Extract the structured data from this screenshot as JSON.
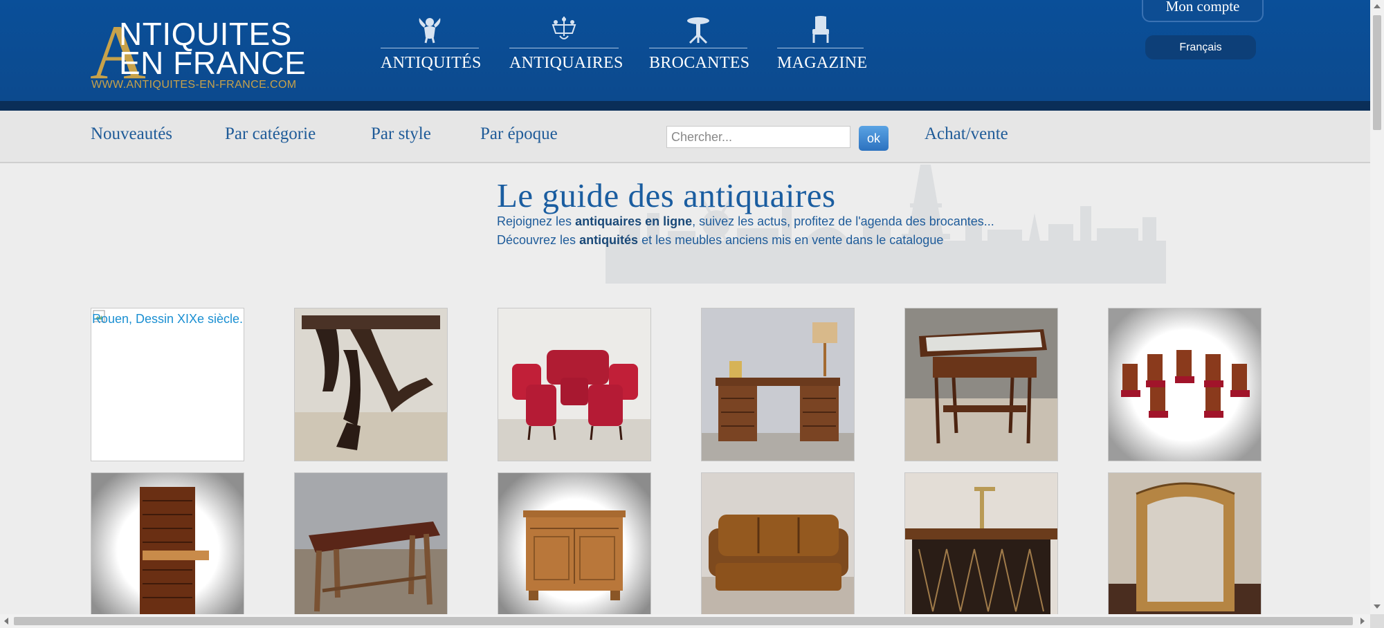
{
  "logo": {
    "big_letter": "A",
    "line1": "NTIQUITES",
    "line2": "EN FRANCE",
    "url": "WWW.ANTIQUITES-EN-FRANCE.COM"
  },
  "main_nav": [
    {
      "label": "ANTIQUITÉS",
      "icon": "cherub-icon"
    },
    {
      "label": "ANTIQUAIRES",
      "icon": "chandelier-icon"
    },
    {
      "label": "BROCANTES",
      "icon": "pedestal-table-icon"
    },
    {
      "label": "MAGAZINE",
      "icon": "armchair-icon"
    }
  ],
  "account": {
    "label": "Mon compte"
  },
  "language": {
    "label": "Français"
  },
  "sub_nav": {
    "items": [
      "Nouveautés",
      "Par catégorie",
      "Par style",
      "Par époque"
    ],
    "extra": "Achat/vente"
  },
  "search": {
    "placeholder": "Chercher...",
    "value": "",
    "button": "ok"
  },
  "intro": {
    "title": "Le guide des antiquaires",
    "p1_a": "Rejoignez les ",
    "p1_b": "antiquaires en ligne",
    "p1_c": ", suivez les actus, profitez de l'agenda des brocantes...",
    "p2_a": "Découvrez les ",
    "p2_b": "antiquités",
    "p2_c": " et les meubles anciens mis en vente dans le catalogue"
  },
  "products_row1": [
    {
      "alt": "Rouen, Dessin XIXe siècle.",
      "broken": true
    },
    {
      "subject": "carved-console-table"
    },
    {
      "subject": "red-salon-set"
    },
    {
      "subject": "writing-desk-with-lamp"
    },
    {
      "subject": "marble-top-table"
    },
    {
      "subject": "set-of-chairs"
    }
  ],
  "products_row2": [
    {
      "subject": "secretary-chest"
    },
    {
      "subject": "farm-table"
    },
    {
      "subject": "sideboard"
    },
    {
      "subject": "leather-sofa"
    },
    {
      "subject": "bar-counter"
    },
    {
      "subject": "gilt-mirror"
    }
  ],
  "colors": {
    "header": "#0a4f99",
    "header_strip": "#0a2e58",
    "accent_gold": "#c8a24a",
    "link_blue": "#1f5b98",
    "ok_button": "#2c72bf"
  }
}
